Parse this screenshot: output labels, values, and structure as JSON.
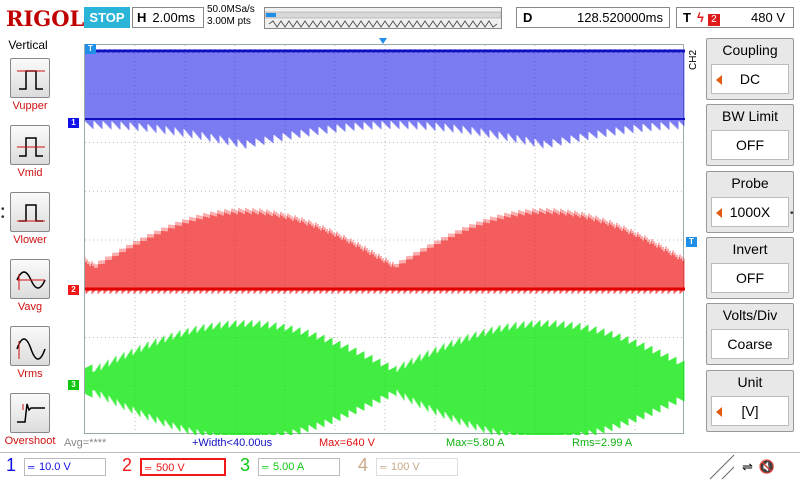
{
  "topbar": {
    "logo": "RIGOL",
    "run_status": "STOP",
    "horizontal_tag": "H",
    "horizontal_scale": "2.00ms",
    "sample_rate": "50.0MSa/s",
    "memory_depth": "3.00M pts",
    "delay_tag": "D",
    "delay_value": "128.520000ms",
    "trigger_tag": "T",
    "trigger_source": "2",
    "trigger_level": "480 V"
  },
  "left_panel": {
    "title": "Vertical",
    "items": [
      {
        "label": "Vupper",
        "icon": "vupper-icon"
      },
      {
        "label": "Vmid",
        "icon": "vmid-icon"
      },
      {
        "label": "Vlower",
        "icon": "vlower-icon"
      },
      {
        "label": "Vavg",
        "icon": "vavg-icon"
      },
      {
        "label": "Vrms",
        "icon": "vrms-icon"
      },
      {
        "label": "Overshoot",
        "icon": "overshoot-icon"
      }
    ]
  },
  "channels": {
    "ch1": {
      "marker": "1",
      "color": "#1010e8",
      "scale": "10.0 V",
      "number": "1"
    },
    "ch2": {
      "marker": "2",
      "color": "#f01818",
      "scale": "500 V",
      "number": "2"
    },
    "ch3": {
      "marker": "3",
      "color": "#10e810",
      "scale": "5.00 A",
      "number": "3"
    },
    "ch4": {
      "number": "4",
      "scale": "100 V",
      "color": "#f0c8a8"
    }
  },
  "measurements": {
    "avg": "Avg=****",
    "width": "+Width<40.00us",
    "max_ch2": "Max=640 V",
    "max_ch3": "Max=5.80 A",
    "rms_ch3": "Rms=2.99 A"
  },
  "right_menu": {
    "channel_label": "CH2",
    "items": [
      {
        "title": "Coupling",
        "value": "DC",
        "arrow": true
      },
      {
        "title": "BW Limit",
        "value": "OFF",
        "arrow": false
      },
      {
        "title": "Probe",
        "value": "1000X",
        "arrow": true
      },
      {
        "title": "Invert",
        "value": "OFF",
        "arrow": false
      },
      {
        "title": "Volts/Div",
        "value": "Coarse",
        "arrow": false
      },
      {
        "title": "Unit",
        "value": "[V]",
        "arrow": true
      }
    ]
  },
  "status_icons": [
    "usb-icon",
    "mute-icon"
  ]
}
